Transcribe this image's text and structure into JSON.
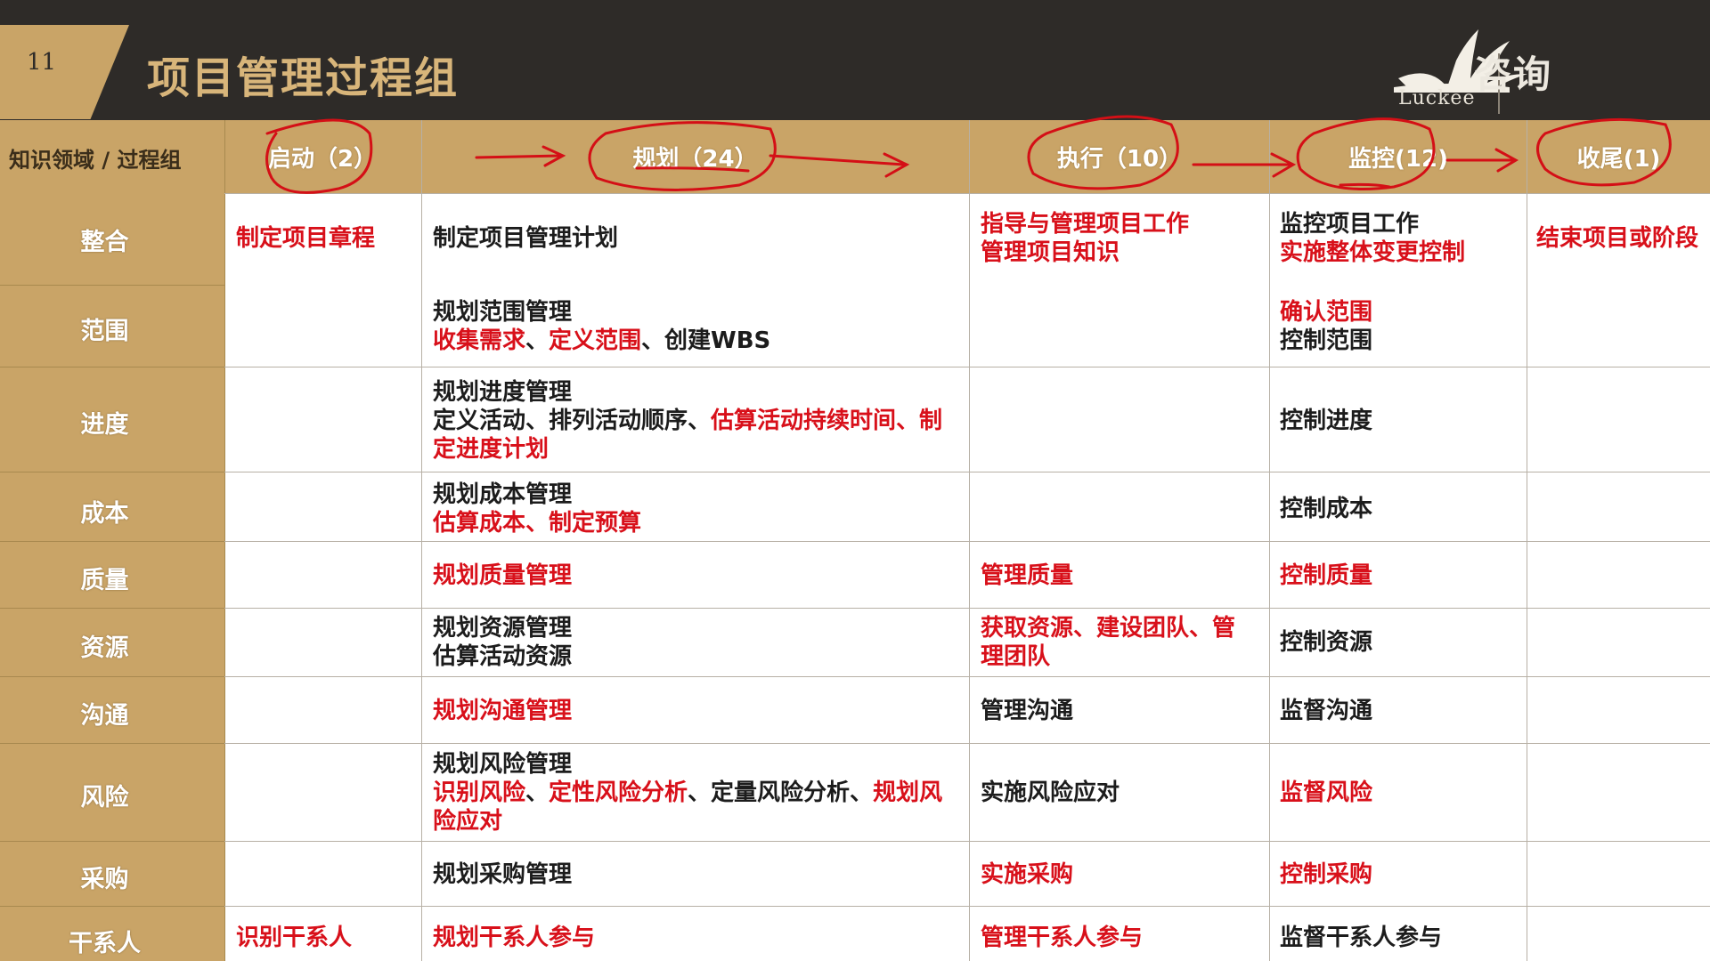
{
  "header": {
    "page_number": "11",
    "title": "项目管理过程组",
    "logo_text": "咨询",
    "logo_brand": "Luckee"
  },
  "table": {
    "corner": "知识领域 / 过程组",
    "columns": [
      "启动（2）",
      "规划（24）",
      "执行（10）",
      "监控(12)",
      "收尾(1)"
    ],
    "rows": [
      {
        "area": "整合",
        "initiating": [
          [
            "制定项目章程",
            "red"
          ]
        ],
        "planning": [
          [
            "制定项目管理计划",
            "blk"
          ]
        ],
        "executing": [
          [
            "指导与管理项目工作",
            "red"
          ],
          [
            "管理项目知识",
            "red"
          ]
        ],
        "monitoring": [
          [
            "监控项目工作",
            "blk"
          ],
          [
            "实施整体变更控制",
            "red"
          ]
        ],
        "closing": [
          [
            "结束项目或阶段",
            "red"
          ]
        ]
      },
      {
        "area": "范围",
        "planning": [
          [
            "规划范围管理",
            "blk"
          ],
          [
            "收集需求",
            "red"
          ],
          [
            "、",
            "blk"
          ],
          [
            "定义范围",
            "red"
          ],
          [
            "、创建WBS",
            "blk"
          ]
        ],
        "monitoring": [
          [
            "确认范围",
            "red"
          ],
          [
            "控制范围",
            "blk"
          ]
        ]
      },
      {
        "area": "进度",
        "planning": [
          [
            "规划进度管理",
            "blk"
          ],
          [
            "定义活动、排列活动顺序、",
            "blk"
          ],
          [
            "估算活动持续时间、制",
            "red"
          ],
          [
            "定进度计划",
            "red"
          ]
        ],
        "monitoring": [
          [
            "控制进度",
            "blk"
          ]
        ]
      },
      {
        "area": "成本",
        "planning": [
          [
            "规划成本管理",
            "blk"
          ],
          [
            "估算成本、制定预算",
            "red"
          ]
        ],
        "monitoring": [
          [
            "控制成本",
            "blk"
          ]
        ]
      },
      {
        "area": "质量",
        "planning": [
          [
            "规划质量管理",
            "red"
          ]
        ],
        "executing": [
          [
            "管理质量",
            "red"
          ]
        ],
        "monitoring": [
          [
            "控制质量",
            "red"
          ]
        ]
      },
      {
        "area": "资源",
        "planning": [
          [
            "规划资源管理",
            "blk"
          ],
          [
            "估算活动资源",
            "blk"
          ]
        ],
        "executing": [
          [
            "获取资源、建设团队、管",
            "red"
          ],
          [
            "理团队",
            "red"
          ]
        ],
        "monitoring": [
          [
            "控制资源",
            "blk"
          ]
        ]
      },
      {
        "area": "沟通",
        "planning": [
          [
            "规划沟通管理",
            "red"
          ]
        ],
        "executing": [
          [
            "管理沟通",
            "blk"
          ]
        ],
        "monitoring": [
          [
            "监督沟通",
            "blk"
          ]
        ]
      },
      {
        "area": "风险",
        "planning": [
          [
            "规划风险管理",
            "blk"
          ],
          [
            "识别风险",
            "red"
          ],
          [
            "、",
            "blk"
          ],
          [
            "定性风险分析",
            "red"
          ],
          [
            "、定量风险分析、",
            "blk"
          ],
          [
            "规划风",
            "red"
          ],
          [
            "险应对",
            "red"
          ]
        ],
        "executing": [
          [
            "实施风险应对",
            "blk"
          ]
        ],
        "monitoring": [
          [
            "监督风险",
            "red"
          ]
        ]
      },
      {
        "area": "采购",
        "planning": [
          [
            "规划采购管理",
            "blk"
          ]
        ],
        "executing": [
          [
            "实施采购",
            "red"
          ]
        ],
        "monitoring": [
          [
            "控制采购",
            "red"
          ]
        ]
      },
      {
        "area": "干系人",
        "initiating": [
          [
            "识别干系人",
            "red"
          ]
        ],
        "planning": [
          [
            "规划干系人参与",
            "red"
          ]
        ],
        "executing": [
          [
            "管理干系人参与",
            "red"
          ]
        ],
        "monitoring": [
          [
            "监督干系人参与",
            "blk"
          ]
        ]
      }
    ]
  },
  "colors": {
    "header_bg": "#2e2b28",
    "accent_gold": "#c9a467",
    "highlight_red": "#d8101a",
    "annotation_red": "#d40f16"
  }
}
